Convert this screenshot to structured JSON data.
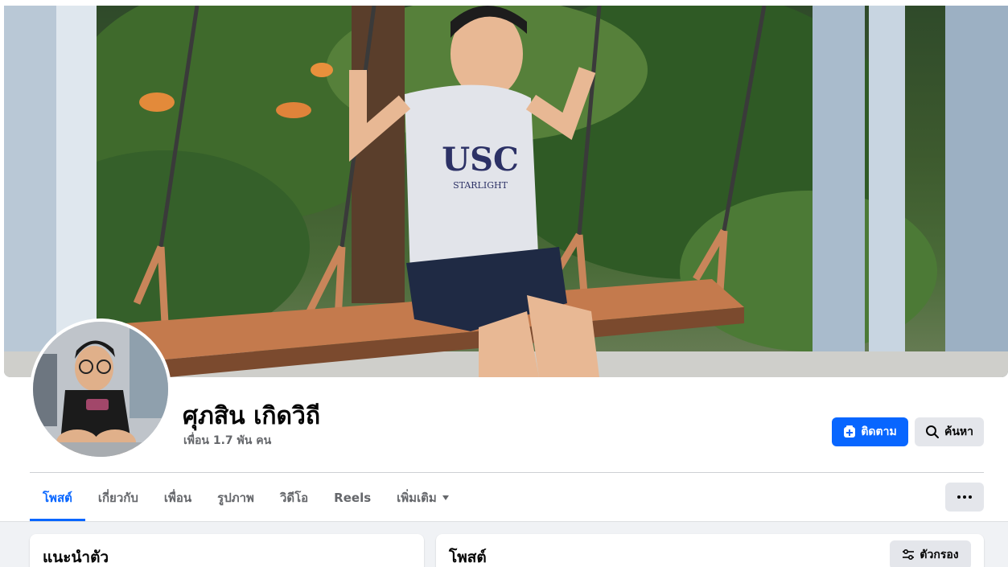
{
  "profile": {
    "name": "ศุภสิน เกิดวิถี",
    "friends": "เพื่อน 1.7 พัน คน"
  },
  "actions": {
    "follow_label": "ติดตาม",
    "search_label": "ค้นหา"
  },
  "tabs": [
    {
      "label": "โพสต์",
      "active": true
    },
    {
      "label": "เกี่ยวกับ",
      "active": false
    },
    {
      "label": "เพื่อน",
      "active": false
    },
    {
      "label": "รูปภาพ",
      "active": false
    },
    {
      "label": "วิดีโอ",
      "active": false
    },
    {
      "label": "Reels",
      "active": false
    },
    {
      "label": "เพิ่มเติม",
      "active": false
    }
  ],
  "intro_card": {
    "title": "แนะนำตัว"
  },
  "posts_card": {
    "title": "โพสต์",
    "filter_label": "ตัวกรอง"
  },
  "cover_photo": {
    "shirt_text": "USC",
    "shirt_subtext": "STARLIGHT"
  },
  "colors": {
    "accent": "#0866ff",
    "secondary_button": "#e4e6eb",
    "muted_text": "#65676b",
    "feed_background": "#f0f2f5"
  },
  "icons": {
    "follow": "follow-plus-icon",
    "search": "search-icon",
    "more": "more-dots-icon",
    "dropdown": "caret-down-icon",
    "filter": "filter-sliders-icon"
  }
}
